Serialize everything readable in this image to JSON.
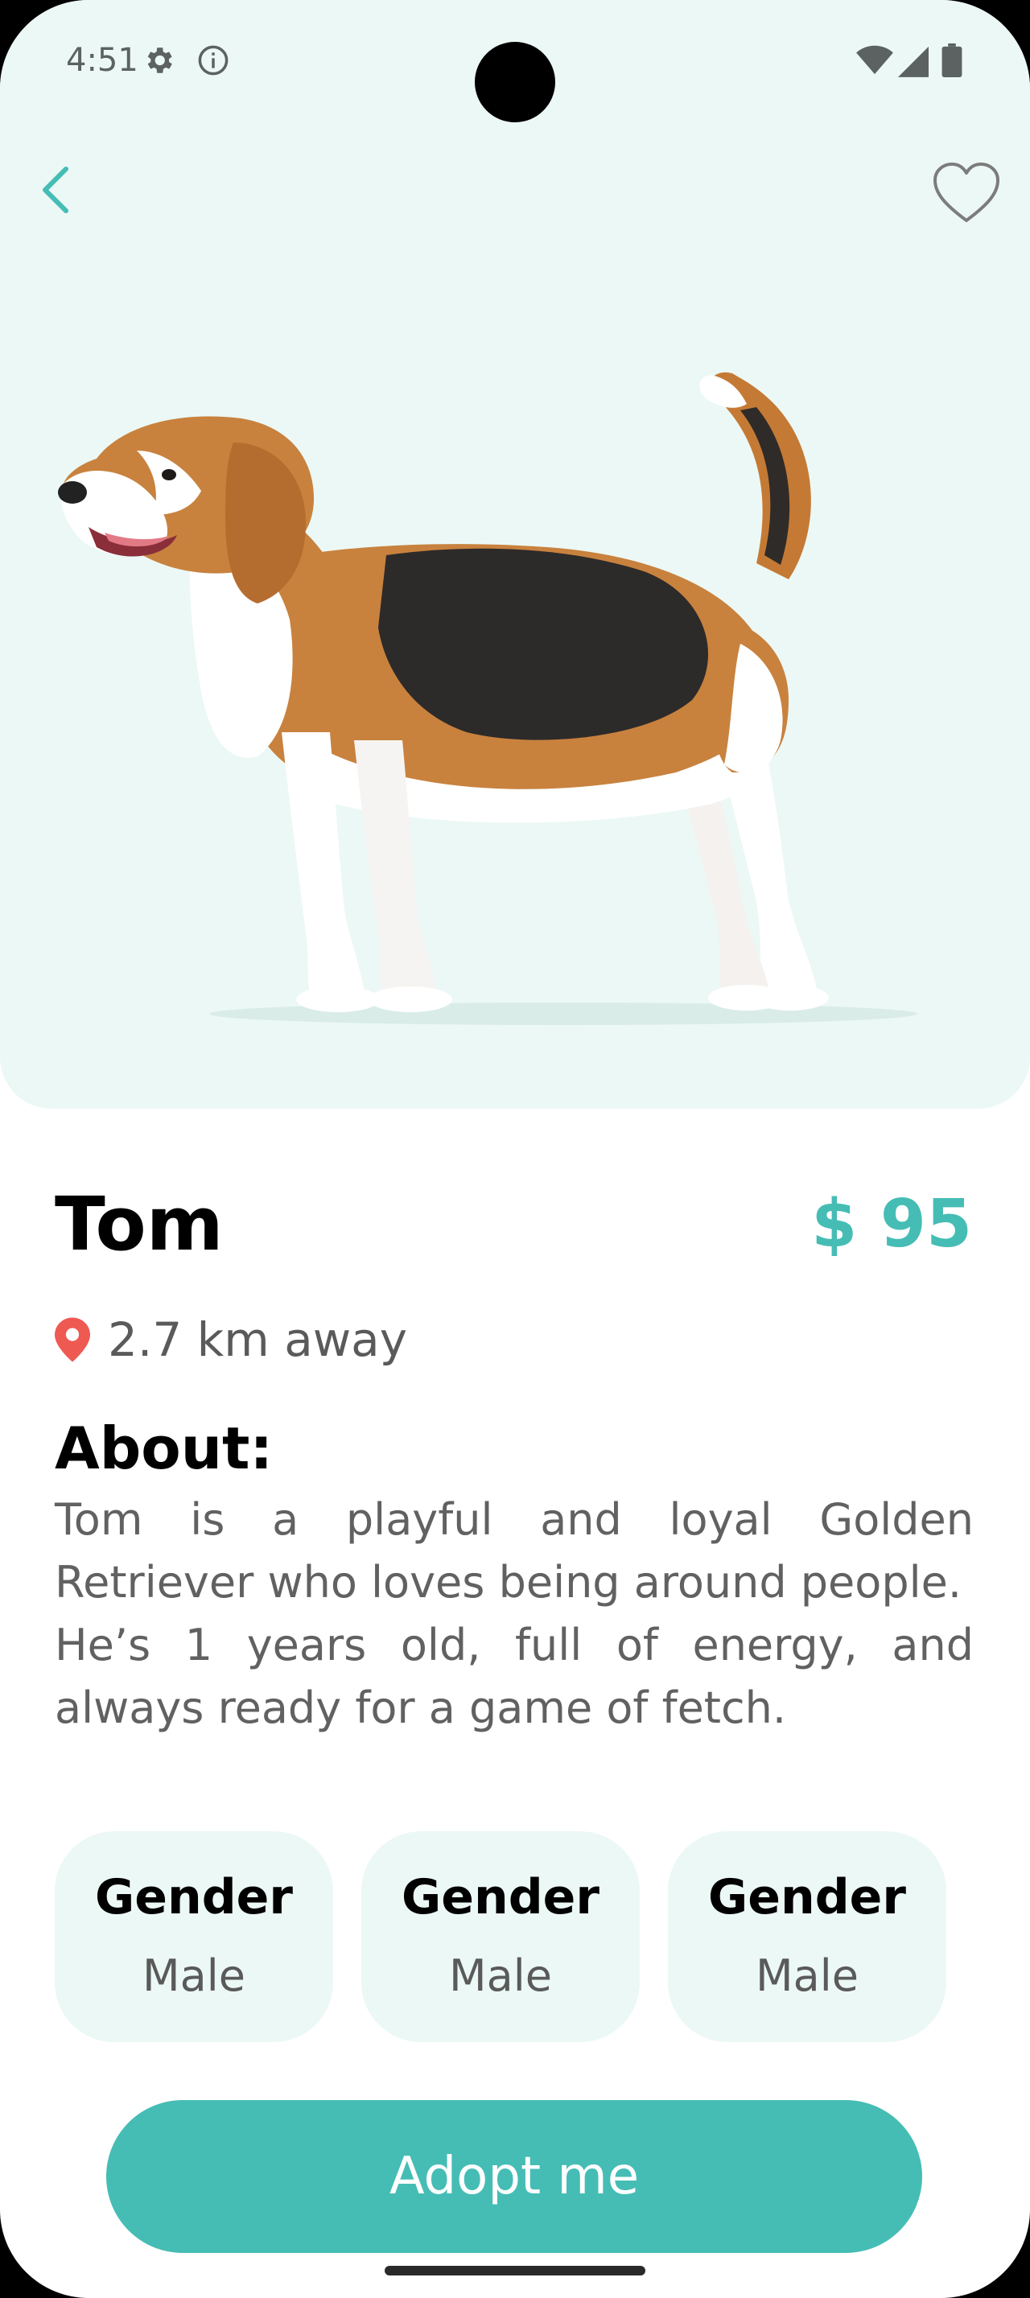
{
  "status_bar": {
    "time": "4:51",
    "icons_left": [
      "gear-icon",
      "info-icon"
    ],
    "icons_right": [
      "wifi-icon",
      "signal-icon",
      "battery-icon"
    ]
  },
  "header": {
    "back_icon": "chevron-left-icon",
    "favorite_icon": "heart-outline-icon"
  },
  "pet": {
    "name": "Tom",
    "price": "$ 95",
    "distance": "2.7 km away",
    "image": "beagle-dog-illustration"
  },
  "about": {
    "heading": "About:",
    "paragraph_1": "Tom is a playful and loyal Golden Retriever who loves being around people.",
    "paragraph_2": "He’s 1 years old, full of energy, and always ready for a game of fetch."
  },
  "attributes": [
    {
      "title": "Gender",
      "value": "Male"
    },
    {
      "title": "Gender",
      "value": "Male"
    },
    {
      "title": "Gender",
      "value": "Male"
    }
  ],
  "actions": {
    "adopt_label": "Adopt me"
  },
  "colors": {
    "accent": "#45bdb5",
    "hero_bg": "#ecf8f5",
    "chip_bg": "#ecf8f5",
    "location_pin": "#ee5a52"
  }
}
